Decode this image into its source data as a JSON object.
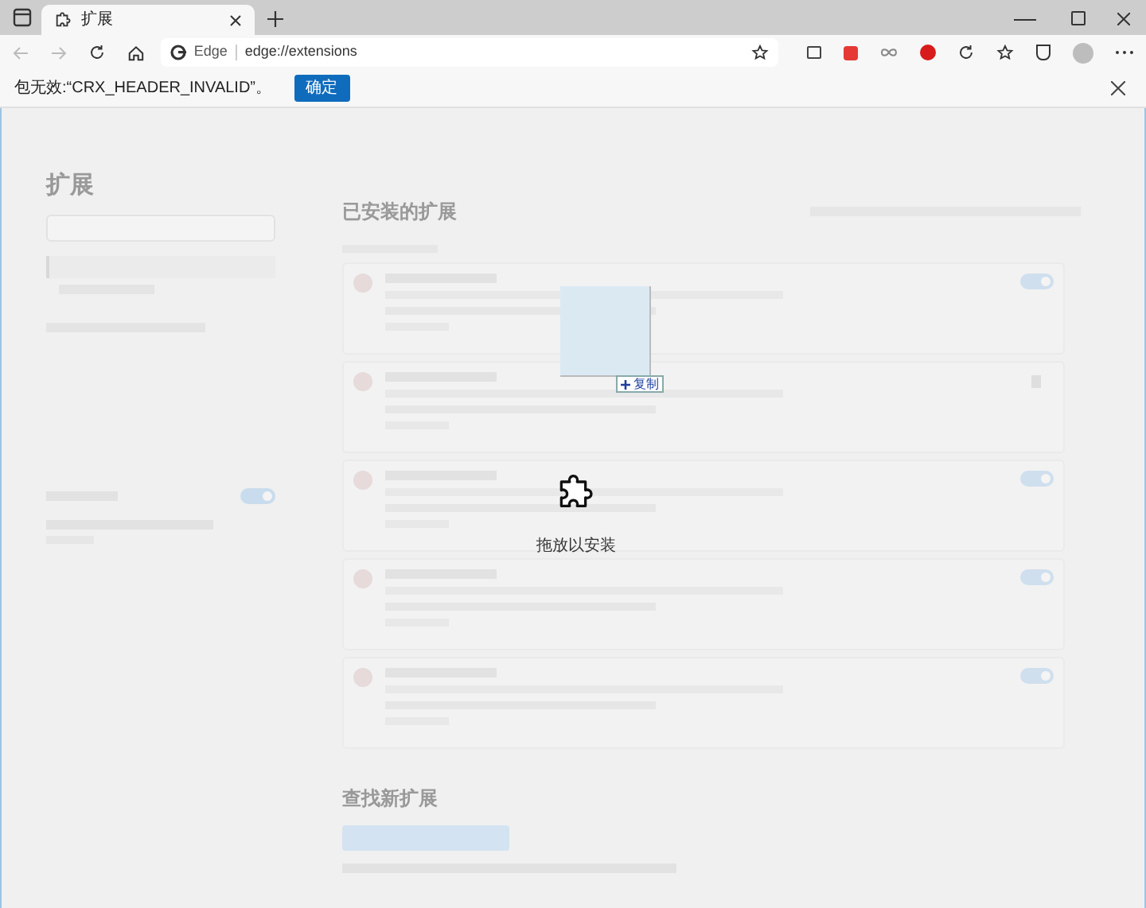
{
  "window": {
    "tab": {
      "title": "扩展"
    }
  },
  "address_bar": {
    "site_label": "Edge",
    "url": "edge://extensions"
  },
  "notification": {
    "message": "包无效:“CRX_HEADER_INVALID”。",
    "button": "确定"
  },
  "page": {
    "sidebar_title": "扩展",
    "sidebar_toggle": {
      "on": true
    },
    "section_title": "已安装的扩展",
    "extensions": [
      {
        "kind": "toggle",
        "on": true
      },
      {
        "kind": "trash"
      },
      {
        "kind": "toggle",
        "on": true
      },
      {
        "kind": "toggle",
        "on": true
      },
      {
        "kind": "toggle",
        "on": true
      }
    ],
    "find_section_title": "查找新扩展"
  },
  "drop_overlay": {
    "label": "拖放以安装",
    "drag_badge": "复制"
  }
}
